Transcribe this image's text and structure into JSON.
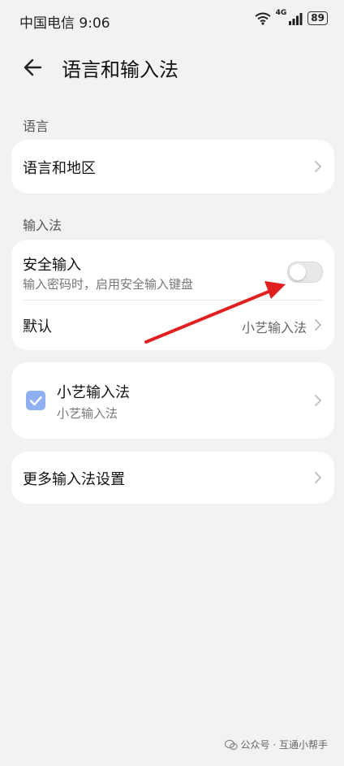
{
  "status_bar": {
    "carrier_time": "中国电信 9:06",
    "network": "4G",
    "battery": "89"
  },
  "header": {
    "title": "语言和输入法"
  },
  "sections": {
    "language_label": "语言",
    "input_label": "输入法"
  },
  "language_card": {
    "region_label": "语言和地区"
  },
  "input_card": {
    "secure_title": "安全输入",
    "secure_subtitle": "输入密码时，启用安全输入键盘",
    "secure_enabled": false,
    "default_label": "默认",
    "default_value": "小艺输入法"
  },
  "ime_card": {
    "name": "小艺输入法",
    "subtitle": "小艺输入法",
    "checked": true
  },
  "more_card": {
    "label": "更多输入法设置"
  },
  "watermark": {
    "text": "公众号 · 互通小帮手"
  },
  "colors": {
    "background": "#f2f2f4",
    "card": "#ffffff",
    "annotation_arrow": "#e02020",
    "checkbox": "#8fb0f0"
  }
}
